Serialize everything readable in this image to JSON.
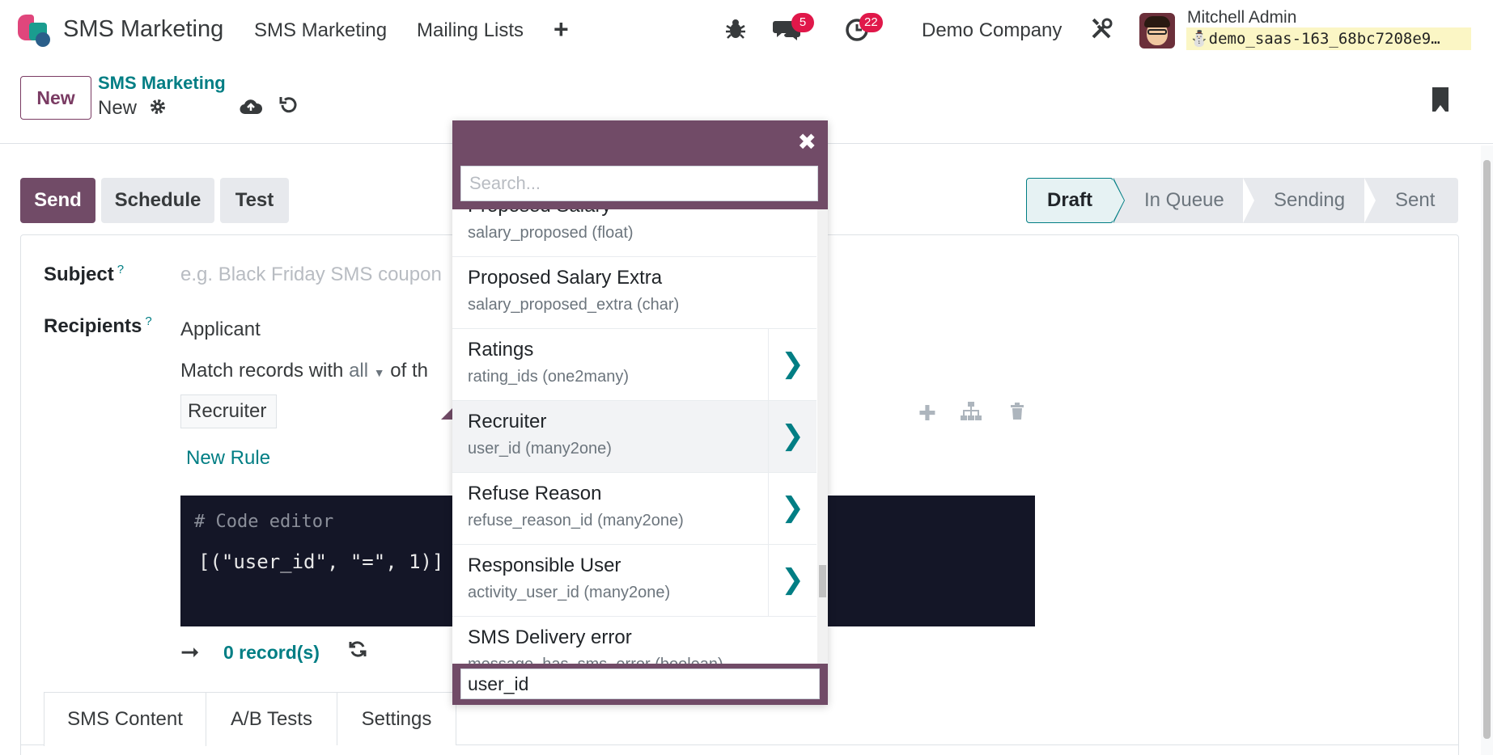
{
  "navbar": {
    "app_title": "SMS Marketing",
    "menu": [
      "SMS Marketing",
      "Mailing Lists"
    ],
    "add_symbol": "+",
    "messages_count": "5",
    "activities_count": "22",
    "company": "Demo Company",
    "user_name": "Mitchell Admin",
    "database": "demo_saas-163_68bc7208e9…"
  },
  "control_panel": {
    "new_button": "New",
    "breadcrumb_parent": "SMS Marketing",
    "breadcrumb_current": "New"
  },
  "actions": {
    "send": "Send",
    "schedule": "Schedule",
    "test": "Test"
  },
  "statusbar": {
    "stages": [
      "Draft",
      "In Queue",
      "Sending",
      "Sent"
    ],
    "active": "Draft"
  },
  "form": {
    "subject_label": "Subject",
    "subject_help": "?",
    "subject_placeholder": "e.g. Black Friday SMS coupon",
    "recipients_label": "Recipients",
    "recipients_help": "?",
    "recipients_model": "Applicant",
    "match_prefix": "Match records with",
    "match_mode": "all",
    "match_suffix": "of th",
    "rule_field": "Recruiter",
    "new_rule": "New Rule",
    "code_comment": "# Code editor",
    "code_domain": "[(\"user_id\", \"=\", 1)]",
    "records_count": "0 record(s)"
  },
  "tabs": [
    "SMS Content",
    "A/B Tests",
    "Settings"
  ],
  "field_selector": {
    "search_placeholder": "Search...",
    "items": [
      {
        "name": "Proposed Salary",
        "tech": "salary_proposed (float)",
        "relational": false
      },
      {
        "name": "Proposed Salary Extra",
        "tech": "salary_proposed_extra (char)",
        "relational": false
      },
      {
        "name": "Ratings",
        "tech": "rating_ids (one2many)",
        "relational": true
      },
      {
        "name": "Recruiter",
        "tech": "user_id (many2one)",
        "relational": true
      },
      {
        "name": "Refuse Reason",
        "tech": "refuse_reason_id (many2one)",
        "relational": true
      },
      {
        "name": "Responsible User",
        "tech": "activity_user_id (many2one)",
        "relational": true
      },
      {
        "name": "SMS Delivery error",
        "tech": "message_has_sms_error (boolean)",
        "relational": false
      }
    ],
    "current_path": "user_id"
  },
  "colors": {
    "brand": "#714b67",
    "accent": "#017e84",
    "badge": "#e0184a"
  }
}
